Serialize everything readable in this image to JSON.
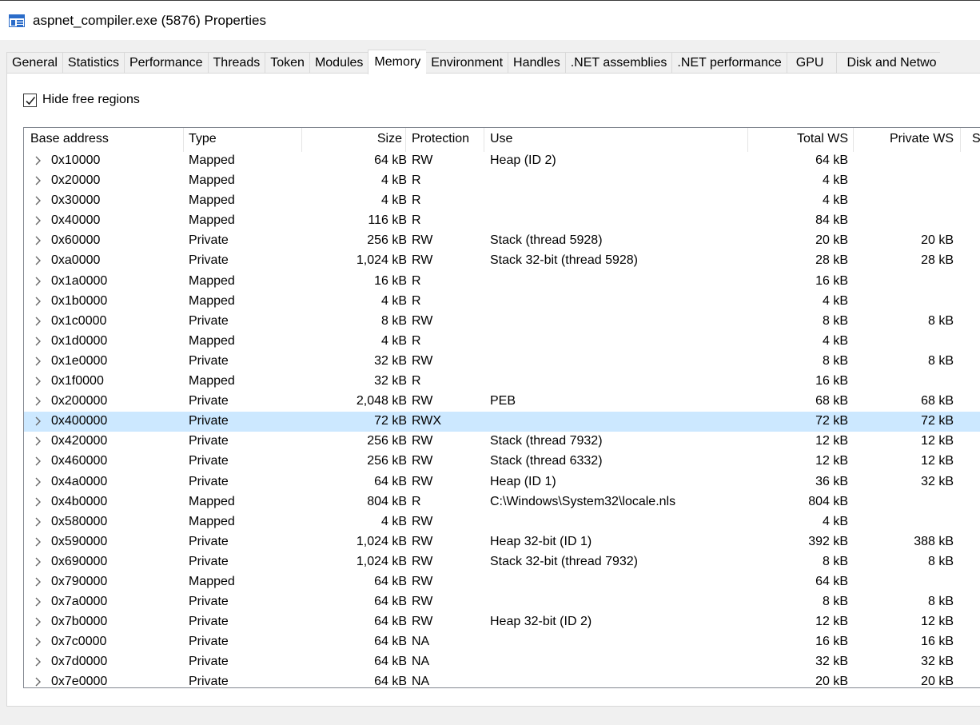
{
  "window": {
    "title": "aspnet_compiler.exe (5876) Properties",
    "icon": "window-icon"
  },
  "tabs": [
    {
      "label": "General",
      "active": false
    },
    {
      "label": "Statistics",
      "active": false
    },
    {
      "label": "Performance",
      "active": false
    },
    {
      "label": "Threads",
      "active": false
    },
    {
      "label": "Token",
      "active": false
    },
    {
      "label": "Modules",
      "active": false
    },
    {
      "label": "Memory",
      "active": true
    },
    {
      "label": "Environment",
      "active": false
    },
    {
      "label": "Handles",
      "active": false
    },
    {
      "label": ".NET assemblies",
      "active": false
    },
    {
      "label": ".NET performance",
      "active": false
    },
    {
      "label": "GPU",
      "active": false
    },
    {
      "label": "Disk and Netwo",
      "active": false
    }
  ],
  "filter": {
    "hide_free_label": "Hide free regions",
    "hide_free_checked": true
  },
  "columns": {
    "base": "Base address",
    "type": "Type",
    "size": "Size",
    "protection": "Protection",
    "use": "Use",
    "total_ws": "Total WS",
    "private_ws": "Private WS",
    "next": "S"
  },
  "rows": [
    {
      "base": "0x10000",
      "type": "Mapped",
      "size": "64 kB",
      "prot": "RW",
      "use": "Heap (ID 2)",
      "total": "64 kB",
      "private": ""
    },
    {
      "base": "0x20000",
      "type": "Mapped",
      "size": "4 kB",
      "prot": "R",
      "use": "",
      "total": "4 kB",
      "private": ""
    },
    {
      "base": "0x30000",
      "type": "Mapped",
      "size": "4 kB",
      "prot": "R",
      "use": "",
      "total": "4 kB",
      "private": ""
    },
    {
      "base": "0x40000",
      "type": "Mapped",
      "size": "116 kB",
      "prot": "R",
      "use": "",
      "total": "84 kB",
      "private": ""
    },
    {
      "base": "0x60000",
      "type": "Private",
      "size": "256 kB",
      "prot": "RW",
      "use": "Stack (thread 5928)",
      "total": "20 kB",
      "private": "20 kB"
    },
    {
      "base": "0xa0000",
      "type": "Private",
      "size": "1,024 kB",
      "prot": "RW",
      "use": "Stack 32-bit (thread 5928)",
      "total": "28 kB",
      "private": "28 kB"
    },
    {
      "base": "0x1a0000",
      "type": "Mapped",
      "size": "16 kB",
      "prot": "R",
      "use": "",
      "total": "16 kB",
      "private": ""
    },
    {
      "base": "0x1b0000",
      "type": "Mapped",
      "size": "4 kB",
      "prot": "R",
      "use": "",
      "total": "4 kB",
      "private": ""
    },
    {
      "base": "0x1c0000",
      "type": "Private",
      "size": "8 kB",
      "prot": "RW",
      "use": "",
      "total": "8 kB",
      "private": "8 kB"
    },
    {
      "base": "0x1d0000",
      "type": "Mapped",
      "size": "4 kB",
      "prot": "R",
      "use": "",
      "total": "4 kB",
      "private": ""
    },
    {
      "base": "0x1e0000",
      "type": "Private",
      "size": "32 kB",
      "prot": "RW",
      "use": "",
      "total": "8 kB",
      "private": "8 kB"
    },
    {
      "base": "0x1f0000",
      "type": "Mapped",
      "size": "32 kB",
      "prot": "R",
      "use": "",
      "total": "16 kB",
      "private": ""
    },
    {
      "base": "0x200000",
      "type": "Private",
      "size": "2,048 kB",
      "prot": "RW",
      "use": "PEB",
      "total": "68 kB",
      "private": "68 kB"
    },
    {
      "base": "0x400000",
      "type": "Private",
      "size": "72 kB",
      "prot": "RWX",
      "use": "",
      "total": "72 kB",
      "private": "72 kB",
      "selected": true
    },
    {
      "base": "0x420000",
      "type": "Private",
      "size": "256 kB",
      "prot": "RW",
      "use": "Stack (thread 7932)",
      "total": "12 kB",
      "private": "12 kB"
    },
    {
      "base": "0x460000",
      "type": "Private",
      "size": "256 kB",
      "prot": "RW",
      "use": "Stack (thread 6332)",
      "total": "12 kB",
      "private": "12 kB"
    },
    {
      "base": "0x4a0000",
      "type": "Private",
      "size": "64 kB",
      "prot": "RW",
      "use": "Heap (ID 1)",
      "total": "36 kB",
      "private": "32 kB"
    },
    {
      "base": "0x4b0000",
      "type": "Mapped",
      "size": "804 kB",
      "prot": "R",
      "use": "C:\\Windows\\System32\\locale.nls",
      "total": "804 kB",
      "private": ""
    },
    {
      "base": "0x580000",
      "type": "Mapped",
      "size": "4 kB",
      "prot": "RW",
      "use": "",
      "total": "4 kB",
      "private": ""
    },
    {
      "base": "0x590000",
      "type": "Private",
      "size": "1,024 kB",
      "prot": "RW",
      "use": "Heap 32-bit (ID 1)",
      "total": "392 kB",
      "private": "388 kB"
    },
    {
      "base": "0x690000",
      "type": "Private",
      "size": "1,024 kB",
      "prot": "RW",
      "use": "Stack 32-bit (thread 7932)",
      "total": "8 kB",
      "private": "8 kB"
    },
    {
      "base": "0x790000",
      "type": "Mapped",
      "size": "64 kB",
      "prot": "RW",
      "use": "",
      "total": "64 kB",
      "private": ""
    },
    {
      "base": "0x7a0000",
      "type": "Private",
      "size": "64 kB",
      "prot": "RW",
      "use": "",
      "total": "8 kB",
      "private": "8 kB"
    },
    {
      "base": "0x7b0000",
      "type": "Private",
      "size": "64 kB",
      "prot": "RW",
      "use": "Heap 32-bit (ID 2)",
      "total": "12 kB",
      "private": "12 kB"
    },
    {
      "base": "0x7c0000",
      "type": "Private",
      "size": "64 kB",
      "prot": "NA",
      "use": "",
      "total": "16 kB",
      "private": "16 kB"
    },
    {
      "base": "0x7d0000",
      "type": "Private",
      "size": "64 kB",
      "prot": "NA",
      "use": "",
      "total": "32 kB",
      "private": "32 kB"
    },
    {
      "base": "0x7e0000",
      "type": "Private",
      "size": "64 kB",
      "prot": "NA",
      "use": "",
      "total": "20 kB",
      "private": "20 kB"
    }
  ],
  "colors": {
    "selection": "#cce8ff",
    "icon_blue": "#2b6cc9",
    "chevron": "#666666"
  }
}
